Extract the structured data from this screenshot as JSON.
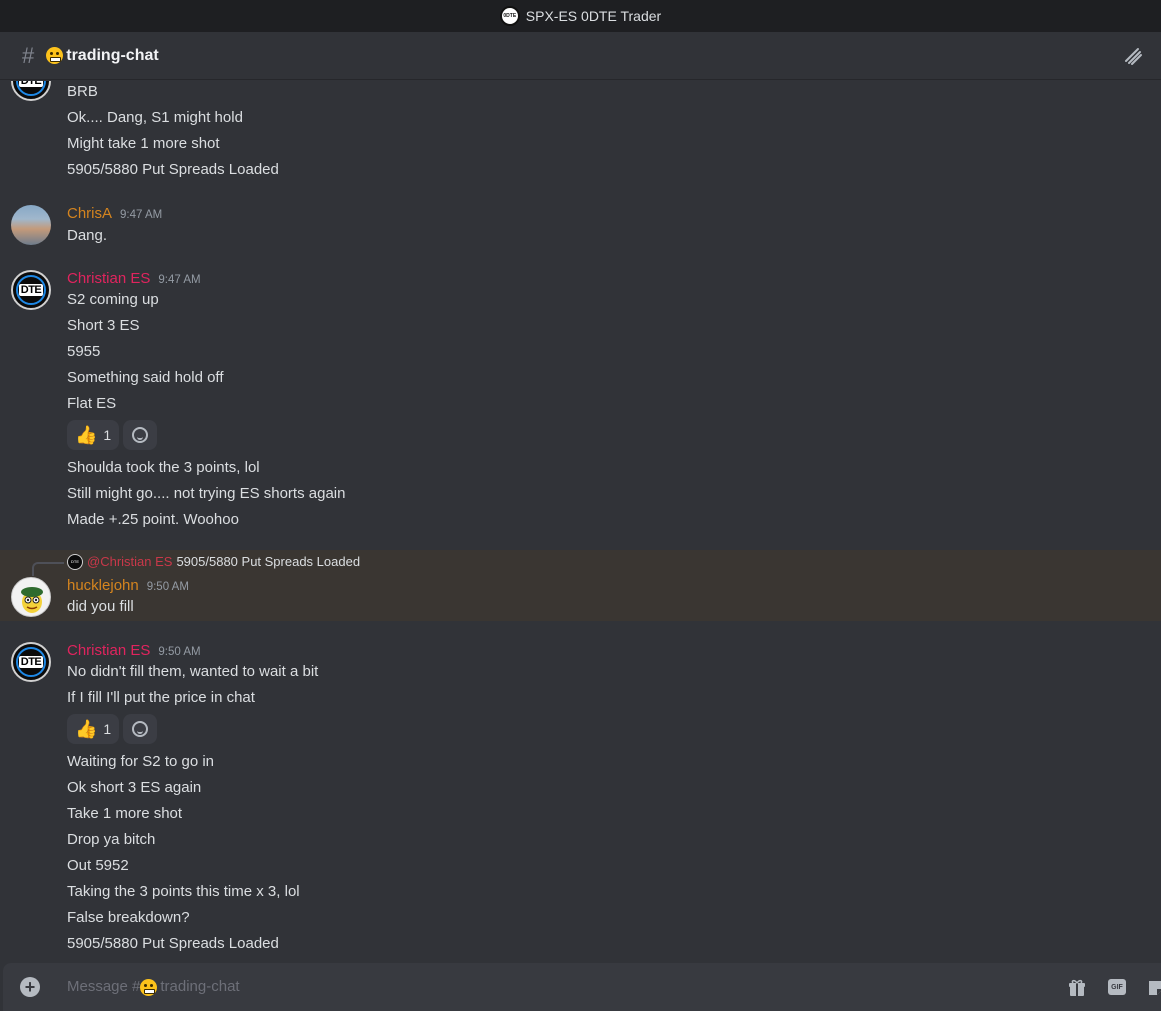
{
  "window": {
    "title": "SPX-ES 0DTE Trader"
  },
  "channel": {
    "name": "trading-chat",
    "emoji_icon": "grinning-face-icon"
  },
  "messages_top": [
    "BRB",
    "Ok.... Dang, S1 might hold",
    "Might take 1 more shot",
    "5905/5880 Put Spreads Loaded"
  ],
  "msg_chrisa": {
    "author": "ChrisA",
    "time": "9:47 AM",
    "lines": [
      "Dang."
    ],
    "author_color": "#d4841f"
  },
  "msg_christian1": {
    "author": "Christian ES",
    "time": "9:47 AM",
    "author_color": "#e0245e",
    "lines": [
      "S2 coming up",
      "Short 3 ES",
      "5955",
      "Something said hold off",
      "Flat ES"
    ],
    "reaction": {
      "emoji": "👍",
      "count": "1"
    },
    "lines_after": [
      "Shoulda took the 3 points, lol",
      "Still might go.... not trying ES shorts again",
      "Made +.25 point. Woohoo"
    ]
  },
  "msg_huckle": {
    "reply_mention": "@Christian ES",
    "reply_snippet": "5905/5880 Put Spreads Loaded",
    "author": "hucklejohn",
    "time": "9:50 AM",
    "author_color": "#d4841f",
    "lines": [
      "did you fill"
    ]
  },
  "msg_christian2": {
    "author": "Christian ES",
    "time": "9:50 AM",
    "author_color": "#e0245e",
    "lines": [
      "No didn't fill them, wanted to wait a bit",
      "If I fill I'll put the price in chat"
    ],
    "reaction": {
      "emoji": "👍",
      "count": "1"
    },
    "lines_after": [
      "Waiting for S2 to go in",
      "Ok short 3 ES again",
      "Take 1 more shot",
      "Drop ya bitch",
      "Out 5952",
      "Taking the 3 points this time x 3, lol",
      "False breakdown?",
      "5905/5880 Put Spreads Loaded"
    ]
  },
  "composer": {
    "placeholder_prefix": "Message #",
    "placeholder_channel": "trading-chat",
    "gif_label": "GIF"
  }
}
